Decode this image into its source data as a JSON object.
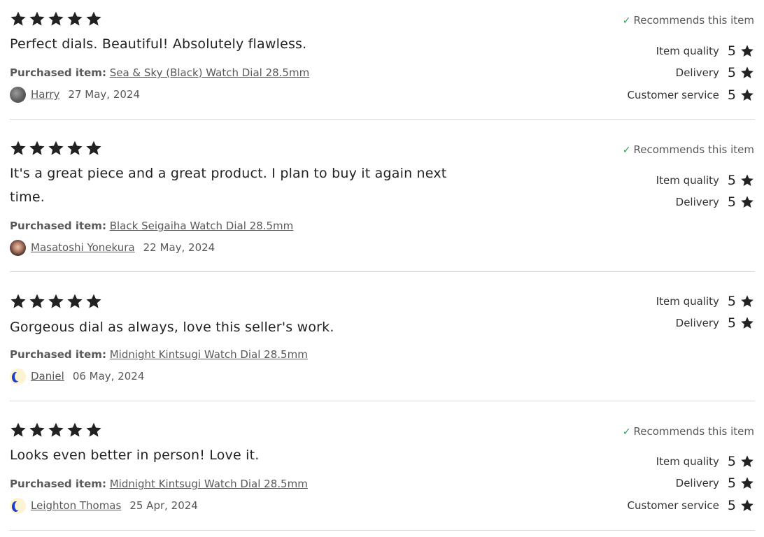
{
  "labels": {
    "purchased_item": "Purchased item:",
    "recommends": "Recommends this item",
    "check_icon": "✓"
  },
  "colors": {
    "star": "#222222",
    "text": "#222222",
    "muted_text": "#595959",
    "check": "#2f9e58",
    "divider": "#d9d9d9"
  },
  "reviews": [
    {
      "stars": 5,
      "recommends": true,
      "text": "Perfect dials. Beautiful! Absolutely flawless.",
      "purchased_item": "Sea & Sky (Black) Watch Dial 28.5mm",
      "author": "Harry",
      "avatar": "harry-avatar",
      "date": "27 May, 2024",
      "ratings": [
        {
          "label": "Item quality",
          "value": "5"
        },
        {
          "label": "Delivery",
          "value": "5"
        },
        {
          "label": "Customer service",
          "value": "5"
        }
      ]
    },
    {
      "stars": 5,
      "recommends": true,
      "text": "It's a great piece and a great product. I plan to buy it again next time.",
      "purchased_item": "Black Seigaiha Watch Dial 28.5mm",
      "author": "Masatoshi Yonekura",
      "avatar": "masatoshi-avatar",
      "date": "22 May, 2024",
      "ratings": [
        {
          "label": "Item quality",
          "value": "5"
        },
        {
          "label": "Delivery",
          "value": "5"
        }
      ]
    },
    {
      "stars": 5,
      "recommends": false,
      "text": "Gorgeous dial as always, love this seller's work.",
      "purchased_item": "Midnight Kintsugi Watch Dial 28.5mm",
      "author": "Daniel",
      "avatar": "daniel-avatar",
      "date": "06 May, 2024",
      "ratings": [
        {
          "label": "Item quality",
          "value": "5"
        },
        {
          "label": "Delivery",
          "value": "5"
        }
      ]
    },
    {
      "stars": 5,
      "recommends": true,
      "text": "Looks even better in person! Love it.",
      "purchased_item": "Midnight Kintsugi Watch Dial 28.5mm",
      "author": "Leighton Thomas",
      "avatar": "leighton-avatar",
      "date": "25 Apr, 2024",
      "ratings": [
        {
          "label": "Item quality",
          "value": "5"
        },
        {
          "label": "Delivery",
          "value": "5"
        },
        {
          "label": "Customer service",
          "value": "5"
        }
      ]
    }
  ]
}
